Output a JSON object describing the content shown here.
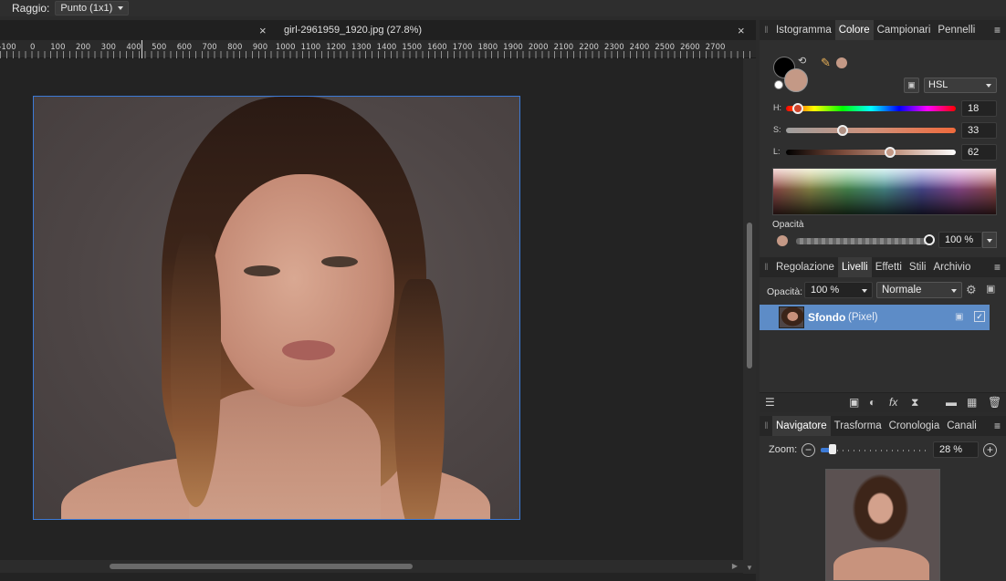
{
  "context_toolbar": {
    "label": "Raggio:",
    "value": "Punto (1x1)"
  },
  "document": {
    "tab_title": "girl-2961959_1920.jpg (27.8%)",
    "ruler_labels": [
      "-100",
      "0",
      "100",
      "200",
      "300",
      "400",
      "500",
      "600",
      "700",
      "800",
      "900",
      "1000",
      "1100",
      "1200",
      "1300",
      "1400",
      "1500",
      "1600",
      "1700",
      "1800",
      "1900",
      "2000",
      "2100",
      "2200",
      "2300",
      "2400",
      "2500",
      "2600",
      "2700"
    ]
  },
  "color_panel": {
    "tabs": [
      "Istogramma",
      "Colore",
      "Campionari",
      "Pennelli"
    ],
    "active_tab": "Colore",
    "mode": "HSL",
    "h_label": "H:",
    "h_value": "18",
    "s_label": "S:",
    "s_value": "33",
    "l_label": "L:",
    "l_value": "62",
    "opacity_label": "Opacità",
    "opacity_value": "100 %",
    "primary_color": "#000000",
    "secondary_color": "#c49986"
  },
  "layers_panel": {
    "tabs": [
      "Regolazione",
      "Livelli",
      "Effetti",
      "Stili",
      "Archivio"
    ],
    "active_tab": "Livelli",
    "opacity_label": "Opacità:",
    "opacity_value": "100 %",
    "blend_mode": "Normale",
    "layers": [
      {
        "name": "Sfondo",
        "type": "(Pixel)",
        "visible": true
      }
    ]
  },
  "navigator_panel": {
    "tabs": [
      "Navigatore",
      "Trasforma",
      "Cronologia",
      "Canali"
    ],
    "active_tab": "Navigatore",
    "zoom_label": "Zoom:",
    "zoom_value": "28 %"
  },
  "icons": {
    "panel_menu": "≡",
    "close": "×",
    "lock": "🔒",
    "gear": "⚙"
  }
}
